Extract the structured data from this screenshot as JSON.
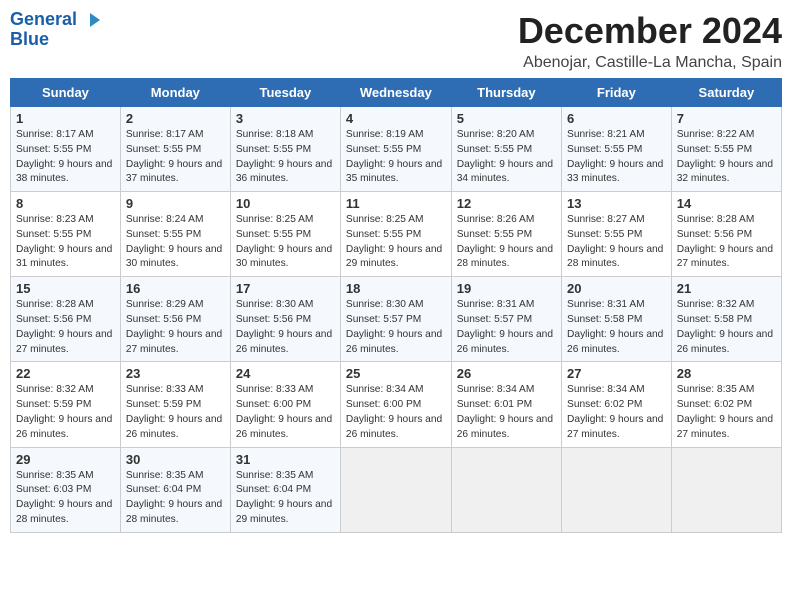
{
  "header": {
    "logo_general": "General",
    "logo_blue": "Blue",
    "month_title": "December 2024",
    "location": "Abenojar, Castille-La Mancha, Spain"
  },
  "weekdays": [
    "Sunday",
    "Monday",
    "Tuesday",
    "Wednesday",
    "Thursday",
    "Friday",
    "Saturday"
  ],
  "weeks": [
    [
      {
        "day": "1",
        "sunrise": "8:17 AM",
        "sunset": "5:55 PM",
        "daylight": "9 hours and 38 minutes."
      },
      {
        "day": "2",
        "sunrise": "8:17 AM",
        "sunset": "5:55 PM",
        "daylight": "9 hours and 37 minutes."
      },
      {
        "day": "3",
        "sunrise": "8:18 AM",
        "sunset": "5:55 PM",
        "daylight": "9 hours and 36 minutes."
      },
      {
        "day": "4",
        "sunrise": "8:19 AM",
        "sunset": "5:55 PM",
        "daylight": "9 hours and 35 minutes."
      },
      {
        "day": "5",
        "sunrise": "8:20 AM",
        "sunset": "5:55 PM",
        "daylight": "9 hours and 34 minutes."
      },
      {
        "day": "6",
        "sunrise": "8:21 AM",
        "sunset": "5:55 PM",
        "daylight": "9 hours and 33 minutes."
      },
      {
        "day": "7",
        "sunrise": "8:22 AM",
        "sunset": "5:55 PM",
        "daylight": "9 hours and 32 minutes."
      }
    ],
    [
      {
        "day": "8",
        "sunrise": "8:23 AM",
        "sunset": "5:55 PM",
        "daylight": "9 hours and 31 minutes."
      },
      {
        "day": "9",
        "sunrise": "8:24 AM",
        "sunset": "5:55 PM",
        "daylight": "9 hours and 30 minutes."
      },
      {
        "day": "10",
        "sunrise": "8:25 AM",
        "sunset": "5:55 PM",
        "daylight": "9 hours and 30 minutes."
      },
      {
        "day": "11",
        "sunrise": "8:25 AM",
        "sunset": "5:55 PM",
        "daylight": "9 hours and 29 minutes."
      },
      {
        "day": "12",
        "sunrise": "8:26 AM",
        "sunset": "5:55 PM",
        "daylight": "9 hours and 28 minutes."
      },
      {
        "day": "13",
        "sunrise": "8:27 AM",
        "sunset": "5:55 PM",
        "daylight": "9 hours and 28 minutes."
      },
      {
        "day": "14",
        "sunrise": "8:28 AM",
        "sunset": "5:56 PM",
        "daylight": "9 hours and 27 minutes."
      }
    ],
    [
      {
        "day": "15",
        "sunrise": "8:28 AM",
        "sunset": "5:56 PM",
        "daylight": "9 hours and 27 minutes."
      },
      {
        "day": "16",
        "sunrise": "8:29 AM",
        "sunset": "5:56 PM",
        "daylight": "9 hours and 27 minutes."
      },
      {
        "day": "17",
        "sunrise": "8:30 AM",
        "sunset": "5:56 PM",
        "daylight": "9 hours and 26 minutes."
      },
      {
        "day": "18",
        "sunrise": "8:30 AM",
        "sunset": "5:57 PM",
        "daylight": "9 hours and 26 minutes."
      },
      {
        "day": "19",
        "sunrise": "8:31 AM",
        "sunset": "5:57 PM",
        "daylight": "9 hours and 26 minutes."
      },
      {
        "day": "20",
        "sunrise": "8:31 AM",
        "sunset": "5:58 PM",
        "daylight": "9 hours and 26 minutes."
      },
      {
        "day": "21",
        "sunrise": "8:32 AM",
        "sunset": "5:58 PM",
        "daylight": "9 hours and 26 minutes."
      }
    ],
    [
      {
        "day": "22",
        "sunrise": "8:32 AM",
        "sunset": "5:59 PM",
        "daylight": "9 hours and 26 minutes."
      },
      {
        "day": "23",
        "sunrise": "8:33 AM",
        "sunset": "5:59 PM",
        "daylight": "9 hours and 26 minutes."
      },
      {
        "day": "24",
        "sunrise": "8:33 AM",
        "sunset": "6:00 PM",
        "daylight": "9 hours and 26 minutes."
      },
      {
        "day": "25",
        "sunrise": "8:34 AM",
        "sunset": "6:00 PM",
        "daylight": "9 hours and 26 minutes."
      },
      {
        "day": "26",
        "sunrise": "8:34 AM",
        "sunset": "6:01 PM",
        "daylight": "9 hours and 26 minutes."
      },
      {
        "day": "27",
        "sunrise": "8:34 AM",
        "sunset": "6:02 PM",
        "daylight": "9 hours and 27 minutes."
      },
      {
        "day": "28",
        "sunrise": "8:35 AM",
        "sunset": "6:02 PM",
        "daylight": "9 hours and 27 minutes."
      }
    ],
    [
      {
        "day": "29",
        "sunrise": "8:35 AM",
        "sunset": "6:03 PM",
        "daylight": "9 hours and 28 minutes."
      },
      {
        "day": "30",
        "sunrise": "8:35 AM",
        "sunset": "6:04 PM",
        "daylight": "9 hours and 28 minutes."
      },
      {
        "day": "31",
        "sunrise": "8:35 AM",
        "sunset": "6:04 PM",
        "daylight": "9 hours and 29 minutes."
      },
      null,
      null,
      null,
      null
    ]
  ]
}
